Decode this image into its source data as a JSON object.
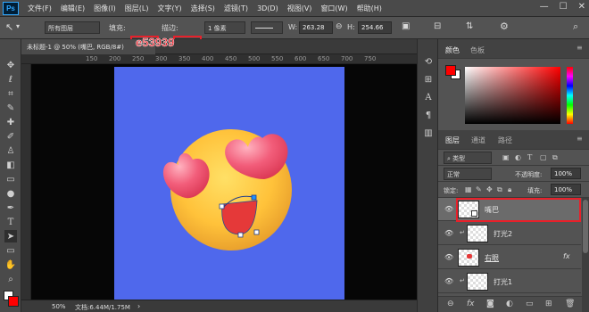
{
  "menu": {
    "logo": "Ps",
    "items": [
      "文件(F)",
      "编辑(E)",
      "图像(I)",
      "图层(L)",
      "文字(Y)",
      "选择(S)",
      "滤镜(T)",
      "3D(D)",
      "视图(V)",
      "窗口(W)",
      "帮助(H)"
    ],
    "minimize": "—",
    "maximize": "☐",
    "close": "✕"
  },
  "options": {
    "all_layers": "所有图层",
    "fill_label": "填充:",
    "fill_color": "#e53939",
    "stroke_label": "描边:",
    "unit": "1 像素",
    "w_label": "W:",
    "w_value": "263.28",
    "h_label": "H:",
    "h_value": "254.66",
    "color_code": "e53939"
  },
  "document": {
    "tab": "未标题-1 @ 50% (嘴巴, RGB/8#)",
    "ruler_ticks": [
      "150",
      "200",
      "250",
      "300",
      "350",
      "400",
      "450",
      "500",
      "550",
      "600",
      "650",
      "700",
      "750"
    ],
    "zoom": "50%",
    "doc_size": "文档:6.44M/1.75M",
    "canvas_color": "#4f68ec"
  },
  "colors": {
    "foreground": "#ff0000",
    "background": "#ffffff",
    "accent_red": "#e8202a"
  },
  "panels": {
    "color_tabs": [
      "颜色",
      "色板"
    ],
    "layer_tabs": [
      "图层",
      "通道",
      "路径"
    ],
    "filter_kind": "类型",
    "blend_mode": "正常",
    "opacity_label": "不透明度:",
    "opacity_value": "100%",
    "lock_label": "锁定:",
    "fill_label": "填充:",
    "fill_value": "100%",
    "layers": [
      {
        "name": "嘴巴",
        "selected": true,
        "fx": ""
      },
      {
        "name": "打光2",
        "selected": false,
        "fx": ""
      },
      {
        "name": "右眼",
        "selected": false,
        "fx": "fx"
      },
      {
        "name": "打光1",
        "selected": false,
        "fx": ""
      }
    ]
  }
}
